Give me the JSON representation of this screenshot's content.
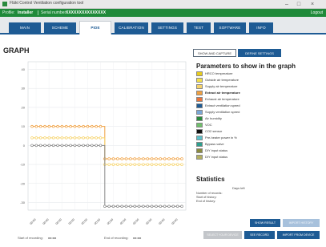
{
  "window": {
    "title": "Fläkt Control Ventilation configuration tool"
  },
  "menubar": {
    "profile_label": "Profile:",
    "profile_value": "Installer",
    "serial_label": "Serial number:",
    "serial_value": "XXXXXXXXXXXXXXX",
    "logout": "Logout"
  },
  "tabs": [
    {
      "label": "MAIN",
      "active": false
    },
    {
      "label": "SCHEME",
      "active": false
    },
    {
      "label": "PIDE",
      "active": true
    },
    {
      "label": "CALIBRATION",
      "active": false
    },
    {
      "label": "SETTINGS",
      "active": false
    },
    {
      "label": "TEST",
      "active": false
    },
    {
      "label": "SOFTWARE",
      "active": false
    },
    {
      "label": "INFO",
      "active": false
    }
  ],
  "graph": {
    "title": "GRAPH",
    "start_label": "Start of recording:",
    "start_value": "xx:xx",
    "end_label": "End of recording:",
    "end_value": "xx:xx"
  },
  "buttons": {
    "show_and_capture": "SHOW AND CAPTURE",
    "define_settings": "DEFINE SETTINGS"
  },
  "parameters": {
    "title": "Parameters to show in the graph",
    "items": [
      {
        "label": "HRCO temperature",
        "color": "#e8cc1c",
        "bold": false
      },
      {
        "label": "Outside air temperature",
        "color": "#f4e04a",
        "bold": false
      },
      {
        "label": "Supply air temperature",
        "color": "#f6d36a",
        "bold": false
      },
      {
        "label": "Extract air temperature",
        "color": "#f0a040",
        "bold": true
      },
      {
        "label": "Exhaust air temperature",
        "color": "#e8743a",
        "bold": false
      },
      {
        "label": "Extract ventilation speed",
        "color": "#1e5b94",
        "bold": false
      },
      {
        "label": "Supply ventilation speed",
        "color": "#7aa7d6",
        "bold": false
      },
      {
        "label": "Air humidity",
        "color": "#2b8a3e",
        "bold": false
      },
      {
        "label": "VOC",
        "color": "#6fbf6a",
        "bold": false
      },
      {
        "label": "CO2 sensor",
        "color": "#111111",
        "bold": false
      },
      {
        "label": "Pre-heater power in %",
        "color": "#5bc0c9",
        "bold": false
      },
      {
        "label": "Bypass valve",
        "color": "#2e9f8e",
        "bold": false
      },
      {
        "label": "DIY input status",
        "color": "#8a8a40",
        "bold": false
      },
      {
        "label": "DIY input status",
        "color": "#b4b060",
        "bold": false
      }
    ]
  },
  "statistics": {
    "title": "Statistics",
    "days_label": "Days left",
    "rows": [
      {
        "label": "Number of records:",
        "value": "unknown"
      },
      {
        "label": "Start of history:",
        "value": "unknown"
      },
      {
        "label": "End of history:",
        "value": "unknown"
      }
    ]
  },
  "bottom_buttons": {
    "show_result": "SHOW RESULT",
    "import_history": "IMPORT HISTORY",
    "select_your_device": "SELECT YOUR DEVICE",
    "see_record": "SEE RECORD",
    "import_from_device": "IMPORT FROM DEVICE"
  },
  "chart_data": {
    "type": "line",
    "y_ticks": [
      40,
      30,
      20,
      10,
      0,
      -10,
      -20,
      -30
    ],
    "ylim": [
      -34,
      44
    ],
    "x_labels": [
      "00:00",
      "00:00",
      "00:00",
      "00:00",
      "00:00",
      "00:00",
      "00:00",
      "00:00",
      "00:00",
      "00:00",
      "00:00",
      "00:00"
    ],
    "series": [
      {
        "color": "#f0a040",
        "values": [
          10,
          10,
          10,
          10,
          10,
          10,
          10,
          10,
          10,
          10,
          10,
          10,
          10,
          10,
          10,
          10,
          10,
          -7,
          -7,
          -7,
          -7,
          -7,
          -7,
          -7,
          -7,
          -7,
          -7,
          -7,
          -7,
          -7,
          -7,
          -7,
          -7,
          -7,
          -7,
          -7
        ]
      },
      {
        "color": "#f6d36a",
        "values": [
          4,
          4,
          4,
          4,
          4,
          4,
          4,
          4,
          4,
          4,
          4,
          4,
          4,
          4,
          4,
          4,
          4,
          -10,
          -10,
          -10,
          -10,
          -10,
          -10,
          -10,
          -10,
          -10,
          -10,
          -10,
          -10,
          -10,
          -10,
          -10,
          -10,
          -10,
          -10,
          -10
        ]
      },
      {
        "color": "#888888",
        "values": [
          0,
          0,
          0,
          0,
          0,
          0,
          0,
          0,
          0,
          0,
          0,
          0,
          0,
          0,
          0,
          0,
          0,
          -32,
          -32,
          -32,
          -32,
          -32,
          -32,
          -32,
          -32,
          -32,
          -32,
          -32,
          -32,
          -32,
          -32,
          -32,
          -32,
          -32,
          -32,
          -32
        ]
      }
    ]
  },
  "colors": {
    "accent": "#1e5b94",
    "brand_green": "#1f8a3a"
  }
}
